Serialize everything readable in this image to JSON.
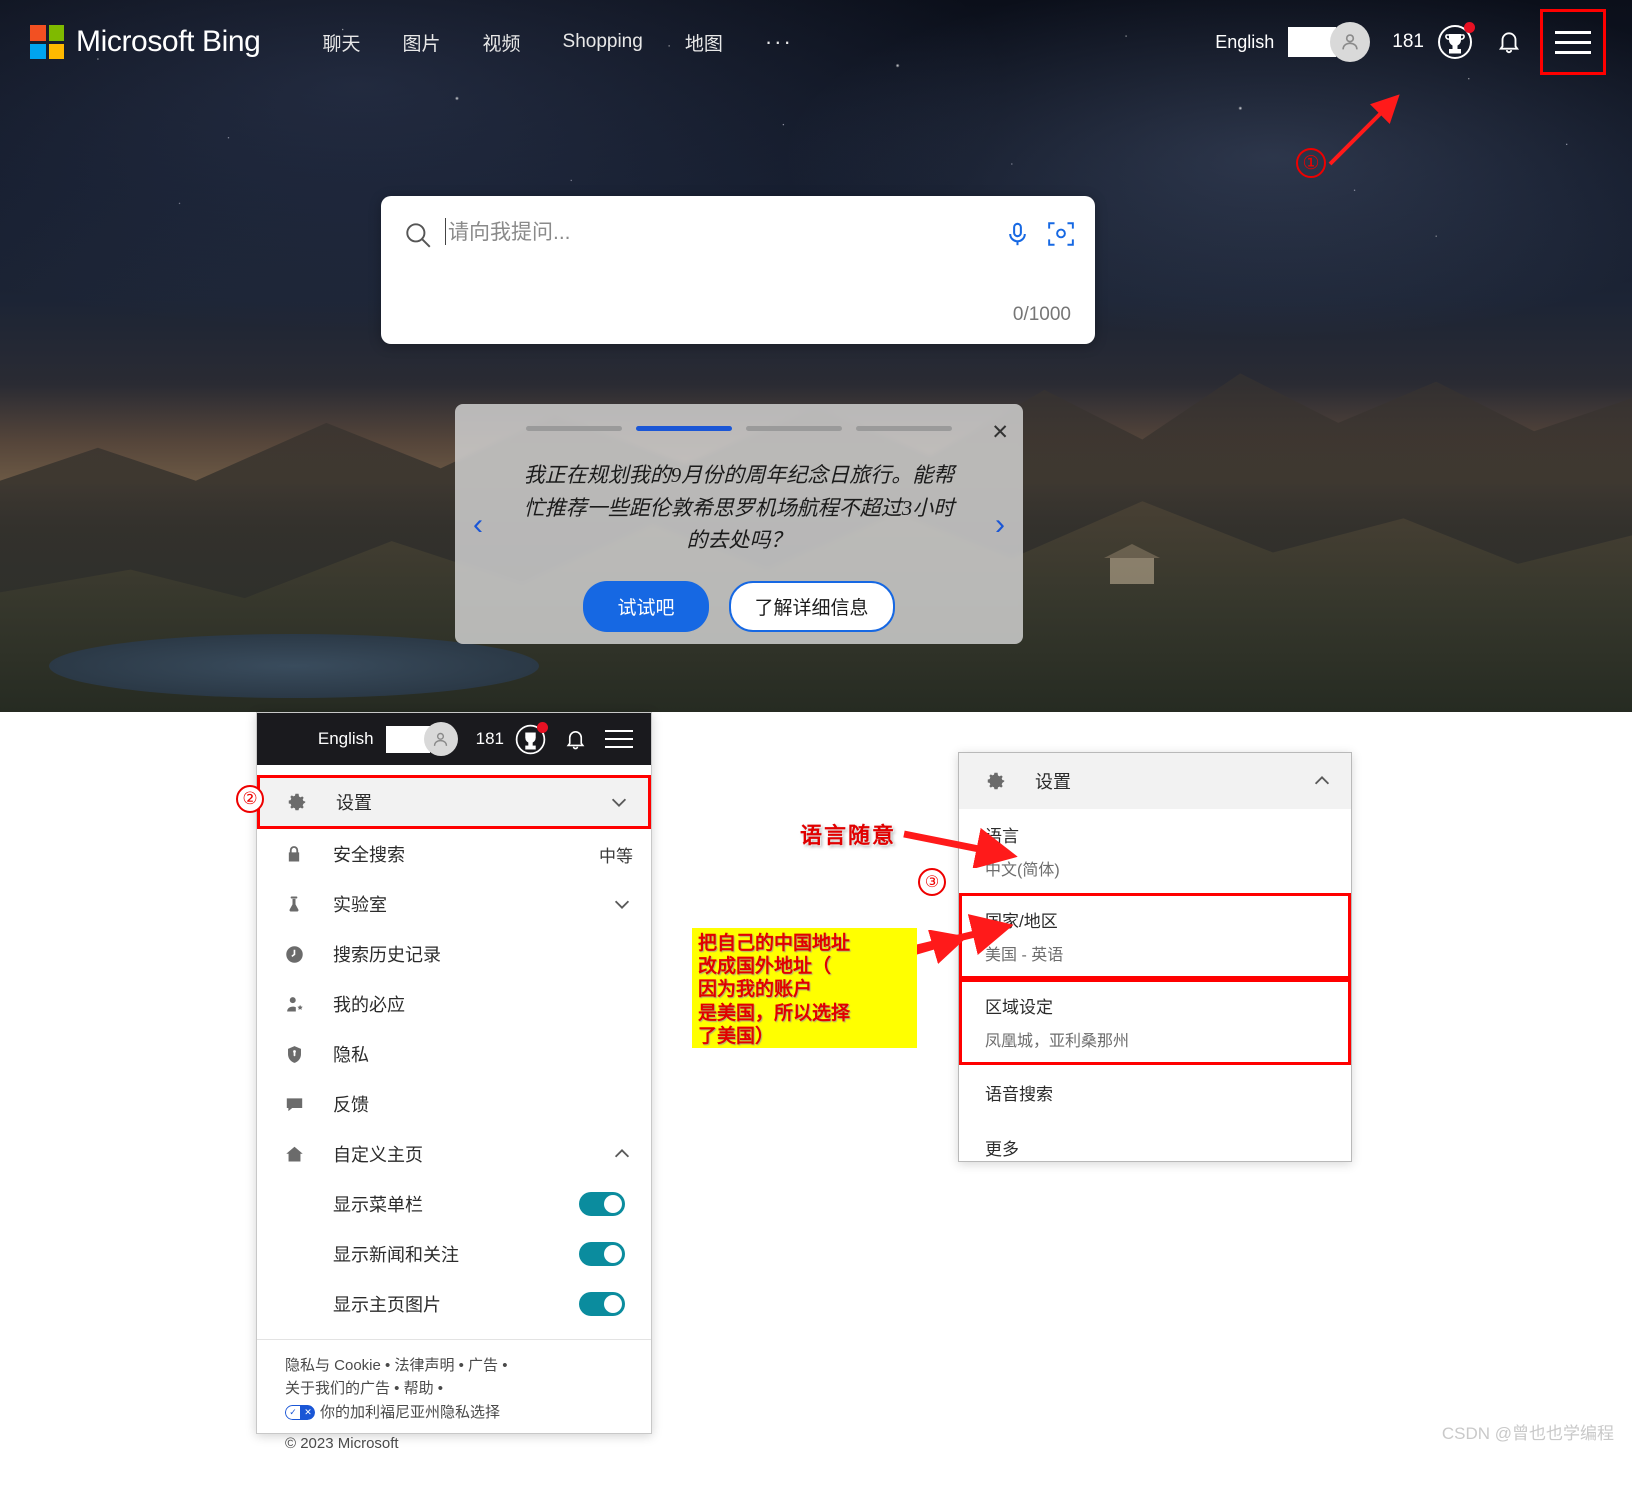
{
  "header": {
    "brand": "Microsoft Bing",
    "nav": [
      {
        "label": "聊天"
      },
      {
        "label": "图片"
      },
      {
        "label": "视频"
      },
      {
        "label": "Shopping"
      },
      {
        "label": "地图"
      }
    ],
    "more": "···",
    "language": "English",
    "points": "181"
  },
  "search": {
    "placeholder": "请向我提问...",
    "value": "",
    "counter": "0/1000"
  },
  "carousel": {
    "slide_count": 4,
    "active_slide": 2,
    "text": "我正在规划我的9月份的周年纪念日旅行。能帮忙推荐一些距伦敦希思罗机场航程不超过3小时的去处吗？",
    "primary_button": "试试吧",
    "secondary_button": "了解详细信息",
    "close": "✕",
    "prev": "‹",
    "next": "›"
  },
  "left_panel": {
    "header": {
      "language": "English",
      "points": "181"
    },
    "items": [
      {
        "label": "设置",
        "icon": "gear-icon",
        "value": "",
        "chevron": "down",
        "highlighted": true
      },
      {
        "label": "安全搜索",
        "icon": "lock-icon",
        "value": "中等",
        "chevron": "",
        "highlighted": false
      },
      {
        "label": "实验室",
        "icon": "flask-icon",
        "value": "",
        "chevron": "down",
        "highlighted": false
      },
      {
        "label": "搜索历史记录",
        "icon": "clock-icon",
        "value": "",
        "chevron": "",
        "highlighted": false
      },
      {
        "label": "我的必应",
        "icon": "person-star-icon",
        "value": "",
        "chevron": "",
        "highlighted": false
      },
      {
        "label": "隐私",
        "icon": "shield-icon",
        "value": "",
        "chevron": "",
        "highlighted": false
      },
      {
        "label": "反馈",
        "icon": "chat-icon",
        "value": "",
        "chevron": "",
        "highlighted": false
      },
      {
        "label": "自定义主页",
        "icon": "home-icon",
        "value": "",
        "chevron": "up",
        "highlighted": false
      }
    ],
    "toggles": [
      {
        "label": "显示菜单栏",
        "on": true
      },
      {
        "label": "显示新闻和关注",
        "on": true
      },
      {
        "label": "显示主页图片",
        "on": true
      }
    ],
    "footer_links": [
      "隐私与 Cookie",
      "法律声明",
      "广告",
      "关于我们的广告",
      "帮助"
    ],
    "footer_line1": "隐私与 Cookie • 法律声明 • 广告 •",
    "footer_line2": "关于我们的广告 • 帮助 •",
    "privacy_choice": "你的加利福尼亚州隐私选择",
    "copyright": "© 2023 Microsoft"
  },
  "right_panel": {
    "header": {
      "label": "设置",
      "icon": "gear-icon",
      "chevron": "up"
    },
    "items": [
      {
        "title": "语言",
        "subtitle": "中文(简体)",
        "boxed": false
      },
      {
        "title": "国家/地区",
        "subtitle": "美国 - 英语",
        "boxed": true
      },
      {
        "title": "区域设定",
        "subtitle": "凤凰城，亚利桑那州",
        "boxed": true
      },
      {
        "title": "语音搜索",
        "subtitle": "",
        "boxed": false
      },
      {
        "title": "更多",
        "subtitle": "",
        "boxed": false
      }
    ]
  },
  "annotations": {
    "marker_1": "①",
    "marker_2": "②",
    "marker_3": "③",
    "language_free": "语言随意",
    "yellow_note_lines": [
      "把自己的中国地址",
      "改成国外地址（",
      "因为我的账户",
      "是美国，所以选择",
      "了美国）"
    ]
  },
  "watermark": "CSDN @曾也也学编程",
  "colors": {
    "accent_blue": "#1668e3",
    "toggle_teal": "#0b8c9e",
    "annotation_red": "#ff0000",
    "highlight_yellow": "#ffff00",
    "header_dark": "#1a1a1e"
  }
}
